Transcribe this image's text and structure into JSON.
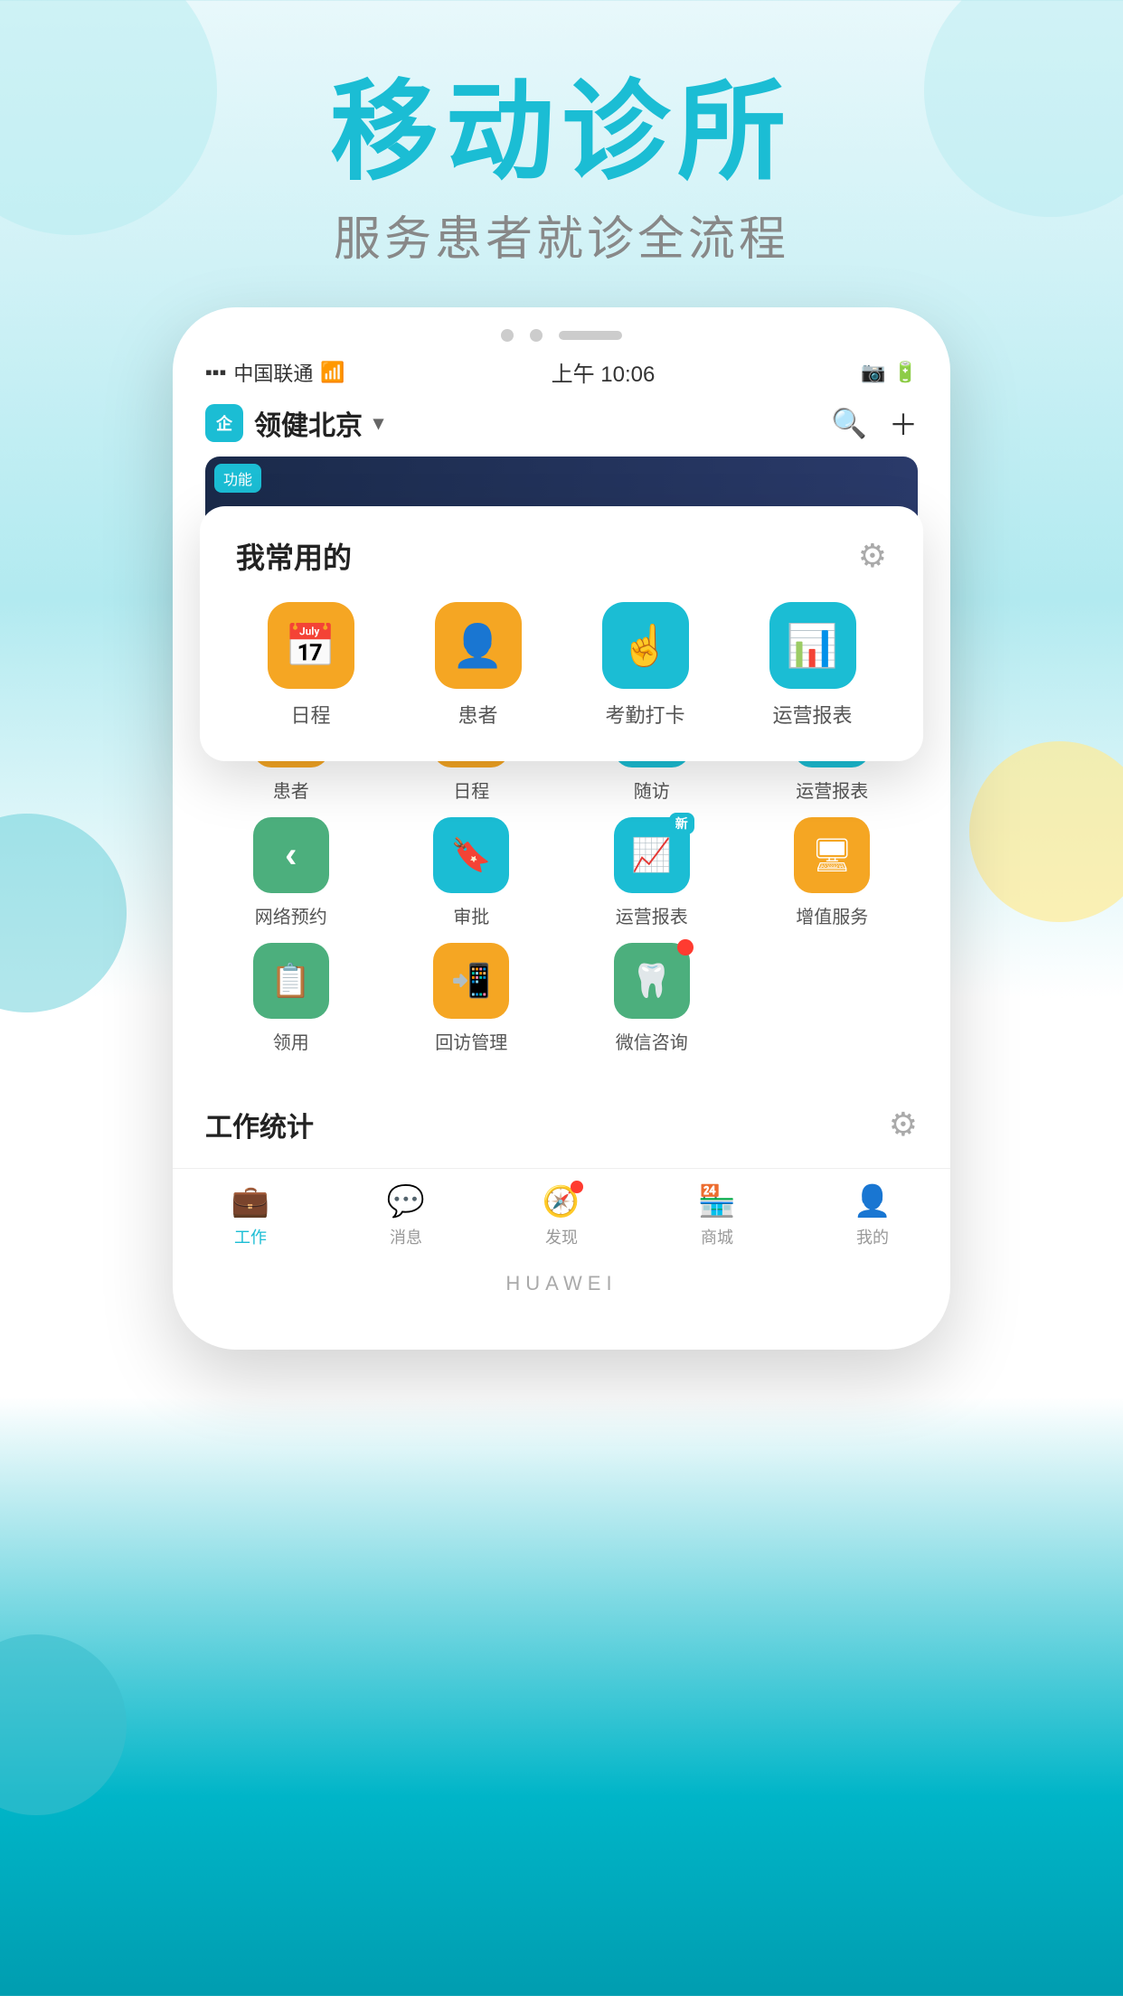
{
  "app": {
    "main_title": "移动诊所",
    "sub_title": "服务患者就诊全流程"
  },
  "status_bar": {
    "carrier": "中国联通",
    "time": "上午 10:06"
  },
  "nav": {
    "enterprise_label": "企",
    "clinic_name": "领健北京"
  },
  "favorite_section": {
    "title": "我常用的",
    "gear_label": "⚙",
    "items": [
      {
        "label": "日程",
        "icon": "📅",
        "color": "yellow"
      },
      {
        "label": "患者",
        "icon": "👤",
        "color": "yellow"
      },
      {
        "label": "考勤打卡",
        "icon": "☝",
        "color": "teal"
      },
      {
        "label": "运营报表",
        "icon": "📊",
        "color": "teal"
      }
    ]
  },
  "app_grid": {
    "rows": [
      [
        {
          "label": "患者",
          "icon": "👤",
          "color": "yellow",
          "badge": null
        },
        {
          "label": "日程",
          "icon": "✅",
          "color": "yellow",
          "badge": null
        },
        {
          "label": "随访",
          "icon": "📞",
          "color": "teal",
          "badge": null
        },
        {
          "label": "运营报表",
          "icon": "📊",
          "color": "teal",
          "badge": null
        }
      ],
      [
        {
          "label": "网络预约",
          "icon": "‹",
          "color": "green",
          "badge": null
        },
        {
          "label": "审批",
          "icon": "✦",
          "color": "teal",
          "badge": null
        },
        {
          "label": "运营报表",
          "icon": "📈",
          "color": "teal",
          "badge": "新"
        },
        {
          "label": "增值服务",
          "icon": "🖥",
          "color": "yellow",
          "badge": null
        }
      ],
      [
        {
          "label": "领用",
          "icon": "⬛",
          "color": "green",
          "badge": null
        },
        {
          "label": "回访管理",
          "icon": "📲",
          "color": "yellow",
          "badge": null
        },
        {
          "label": "微信咨询",
          "icon": "🦷",
          "color": "green",
          "badge": "red"
        },
        {
          "label": "",
          "icon": "",
          "color": "none",
          "badge": null
        }
      ]
    ]
  },
  "work_stats": {
    "title": "工作统计",
    "gear_label": "⚙"
  },
  "bottom_nav": {
    "items": [
      {
        "label": "工作",
        "icon": "💼",
        "active": true,
        "badge": null
      },
      {
        "label": "消息",
        "icon": "💬",
        "active": false,
        "badge": null
      },
      {
        "label": "发现",
        "icon": "🧭",
        "active": false,
        "badge": "red"
      },
      {
        "label": "商城",
        "icon": "🏪",
        "active": false,
        "badge": null
      },
      {
        "label": "我的",
        "icon": "👤",
        "active": false,
        "badge": null
      }
    ]
  },
  "huawei_label": "HUAWEI"
}
